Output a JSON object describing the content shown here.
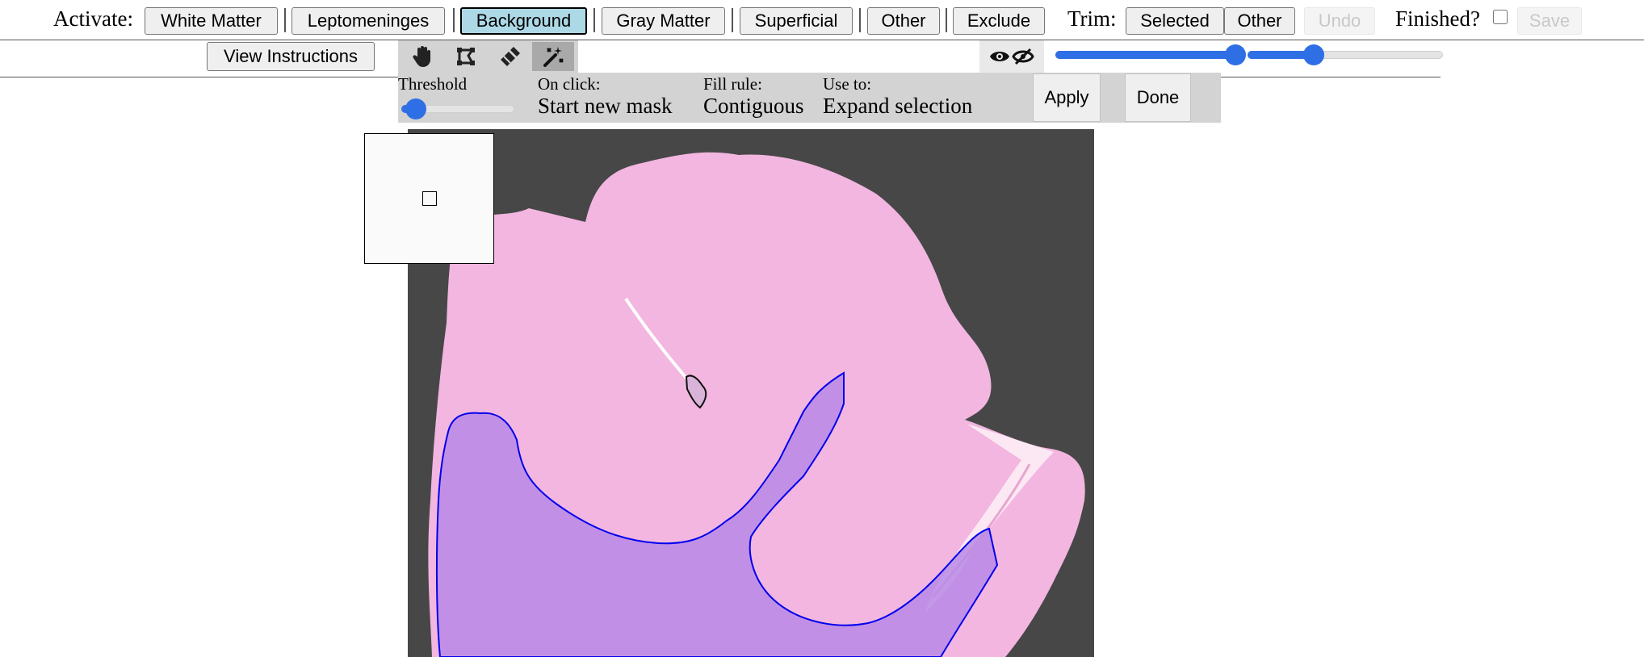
{
  "header": {
    "activate_label": "Activate:",
    "layers": [
      {
        "label": "White Matter",
        "active": false
      },
      {
        "label": "Leptomeninges",
        "active": false
      },
      {
        "label": "Background",
        "active": true
      },
      {
        "label": "Gray Matter",
        "active": false
      },
      {
        "label": "Superficial",
        "active": false
      },
      {
        "label": "Other",
        "active": false
      },
      {
        "label": "Exclude",
        "active": false
      }
    ],
    "trim_label": "Trim:",
    "trim_selected": "Selected",
    "trim_other": "Other",
    "undo_label": "Undo",
    "finished_label": "Finished?",
    "finished_checked": false,
    "save_label": "Save"
  },
  "instructions_button": "View Instructions",
  "tools": [
    {
      "name": "pan",
      "icon": "hand-icon",
      "selected": false
    },
    {
      "name": "polygon",
      "icon": "polygon-select-icon",
      "selected": false
    },
    {
      "name": "brush",
      "icon": "brush-icon",
      "selected": false
    },
    {
      "name": "magic-wand",
      "icon": "magic-wand-icon",
      "selected": true
    }
  ],
  "visibility_icons": [
    "eye-open-icon",
    "eye-closed-icon"
  ],
  "opacity_sliders": {
    "first_fraction": 0.47,
    "second_fraction": 0.34
  },
  "options": {
    "threshold_label": "Threshold",
    "threshold_fraction": 0.08,
    "on_click_label": "On click:",
    "on_click_value": "Start new mask",
    "fill_rule_label": "Fill rule:",
    "fill_rule_value": "Contiguous",
    "use_to_label": "Use to:",
    "use_to_value": "Expand selection",
    "apply_label": "Apply",
    "done_label": "Done"
  },
  "colors": {
    "accent": "#2f6fe6",
    "active_layer": "#add8e6",
    "slide_background": "#474747",
    "tissue_pink": "#f2b6e0",
    "white_matter_fill": "#b98ae6",
    "annotation_outline": "#0000ee"
  }
}
